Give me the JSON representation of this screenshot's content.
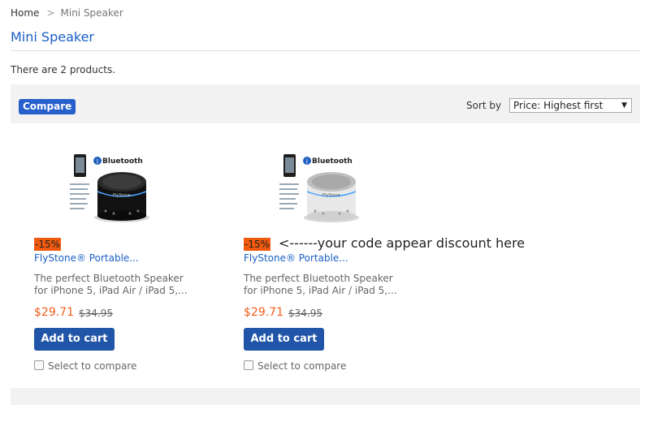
{
  "breadcrumb": {
    "home": "Home",
    "separator": ">",
    "current": "Mini Speaker"
  },
  "page": {
    "title": "Mini Speaker",
    "count_text": "There are 2 products."
  },
  "toolbar": {
    "compare_label": "Compare",
    "sort_label": "Sort by",
    "sort_selected": "Price: Highest first"
  },
  "products": [
    {
      "variant": "black",
      "discount": "-15%",
      "name": "FlyStone® Portable...",
      "description": "The perfect Bluetooth Speaker for iPhone 5, iPad Air / iPad 5,...",
      "price": "$29.71",
      "old_price": "$34.95",
      "add_to_cart": "Add to cart",
      "compare_label": "Select to compare",
      "image_caption": "Bluetooth"
    },
    {
      "variant": "silver",
      "discount": "-15%",
      "discount_note": "<------your code appear discount here",
      "name": "FlyStone® Portable...",
      "description": "The perfect Bluetooth Speaker for iPhone 5, iPad Air / iPad 5,...",
      "price": "$29.71",
      "old_price": "$34.95",
      "add_to_cart": "Add to cart",
      "compare_label": "Select to compare",
      "image_caption": "Bluetooth"
    }
  ],
  "colors": {
    "link": "#1a5fc4",
    "price": "#f05c17",
    "badge": "#f15a0c",
    "button": "#2055a8",
    "compare_button": "#2760cc",
    "toolbar_bg": "#f2f2f2"
  }
}
